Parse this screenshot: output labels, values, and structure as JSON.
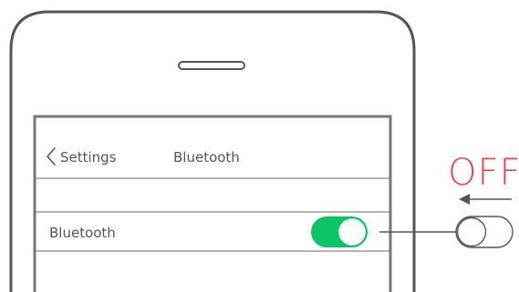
{
  "nav": {
    "back_label": "Settings",
    "title": "Bluetooth"
  },
  "settings": {
    "row_label": "Bluetooth"
  },
  "callout": {
    "state_label": "OFF"
  },
  "colors": {
    "toggle_on": "#0ac466",
    "off_accent": "#e8454a",
    "frame": "#555555",
    "divider": "#6a6a6a"
  },
  "icons": {
    "back": "chevron-left-icon",
    "speaker": "speaker-slot-icon",
    "arrow": "left-arrow-icon"
  }
}
